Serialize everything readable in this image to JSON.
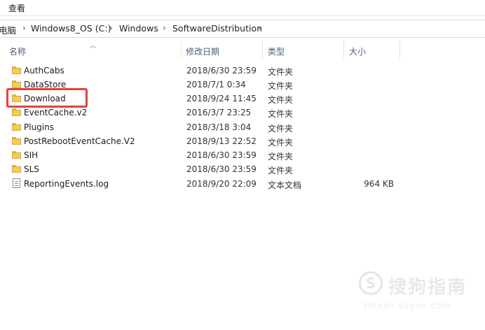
{
  "menubar": {
    "view_label": "查看"
  },
  "breadcrumb": {
    "items": [
      "电脑",
      "Windows8_OS (C:)",
      "Windows",
      "SoftwareDistribution"
    ],
    "separator": "›"
  },
  "columns": {
    "name": "名称",
    "date": "修改日期",
    "type": "类型",
    "size": "大小"
  },
  "files": [
    {
      "name": "AuthCabs",
      "date": "2018/6/30 23:59",
      "type": "文件夹",
      "size": "",
      "icon": "folder-icon"
    },
    {
      "name": "DataStore",
      "date": "2018/7/1 0:34",
      "type": "文件夹",
      "size": "",
      "icon": "folder-icon"
    },
    {
      "name": "Download",
      "date": "2018/9/24 11:45",
      "type": "文件夹",
      "size": "",
      "icon": "folder-icon"
    },
    {
      "name": "EventCache.v2",
      "date": "2016/3/7 23:25",
      "type": "文件夹",
      "size": "",
      "icon": "folder-icon"
    },
    {
      "name": "Plugins",
      "date": "2018/3/18 3:04",
      "type": "文件夹",
      "size": "",
      "icon": "folder-icon"
    },
    {
      "name": "PostRebootEventCache.V2",
      "date": "2018/9/13 22:52",
      "type": "文件夹",
      "size": "",
      "icon": "folder-icon"
    },
    {
      "name": "SIH",
      "date": "2018/6/30 23:59",
      "type": "文件夹",
      "size": "",
      "icon": "folder-icon"
    },
    {
      "name": "SLS",
      "date": "2018/6/30 23:59",
      "type": "文件夹",
      "size": "",
      "icon": "folder-icon"
    },
    {
      "name": "ReportingEvents.log",
      "date": "2018/9/20 22:09",
      "type": "文本文档",
      "size": "964 KB",
      "icon": "text-file-icon"
    }
  ],
  "highlight_color": "#e8413b",
  "watermark": {
    "text": "搜狗指南",
    "url": "zhinan.sogou.com"
  }
}
